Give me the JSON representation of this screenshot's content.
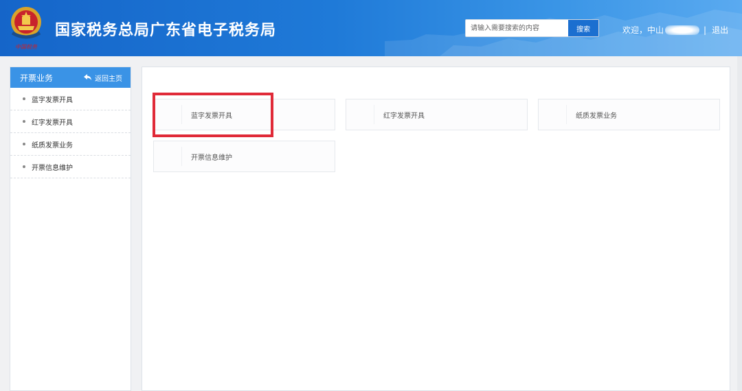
{
  "header": {
    "title": "国家税务总局广东省电子税务局",
    "logo_text": "中国税务",
    "search_placeholder": "请输入需要搜索的内容",
    "search_button": "搜索",
    "welcome": "欢迎，中山",
    "separator": "|",
    "logout": "退出"
  },
  "sidebar": {
    "title": "开票业务",
    "back_label": "返回主页",
    "items": [
      {
        "label": "蓝字发票开具"
      },
      {
        "label": "红字发票开具"
      },
      {
        "label": "纸质发票业务"
      },
      {
        "label": "开票信息维护"
      }
    ]
  },
  "main": {
    "cards": [
      {
        "label": "蓝字发票开具"
      },
      {
        "label": "红字发票开具"
      },
      {
        "label": "纸质发票业务"
      },
      {
        "label": "开票信息维护"
      }
    ]
  },
  "colors": {
    "header_blue": "#1f7ad8",
    "sidebar_header": "#3a93e6",
    "highlight_red": "#e02a38"
  }
}
